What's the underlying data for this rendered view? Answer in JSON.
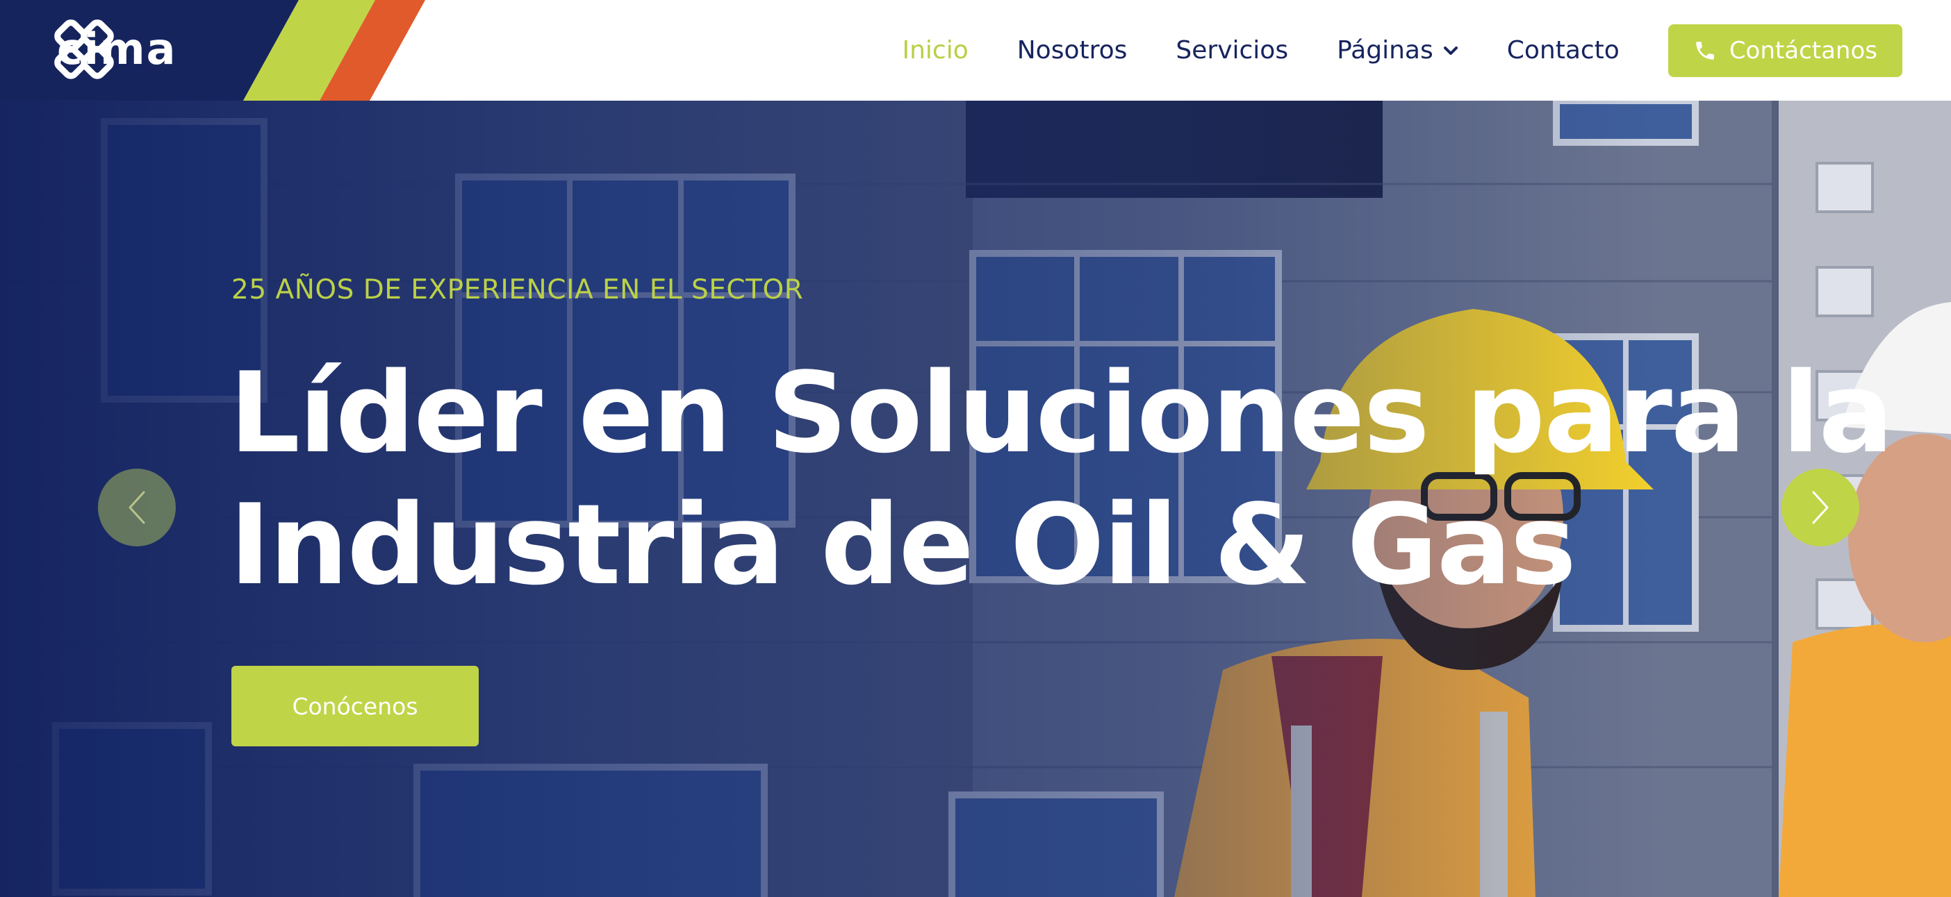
{
  "brand": {
    "name": "cima",
    "logo_icon": "cima-knot-logo",
    "colors": {
      "navy": "#16245e",
      "lime": "#c0d447",
      "orange": "#e05a2b"
    }
  },
  "nav": {
    "items": [
      {
        "label": "Inicio",
        "active": true
      },
      {
        "label": "Nosotros",
        "active": false
      },
      {
        "label": "Servicios",
        "active": false
      },
      {
        "label": "Páginas",
        "active": false,
        "has_dropdown": true
      },
      {
        "label": "Contacto",
        "active": false
      }
    ],
    "cta_label": "Contáctanos",
    "cta_icon": "phone-icon"
  },
  "hero": {
    "eyebrow": "25 AÑOS DE EXPERIENCIA EN EL SECTOR",
    "headline_line1": "Líder en Soluciones para la",
    "headline_line2": "Industria de Oil & Gas",
    "button_label": "Conócenos",
    "prev_icon": "chevron-left-icon",
    "next_icon": "chevron-right-icon"
  }
}
